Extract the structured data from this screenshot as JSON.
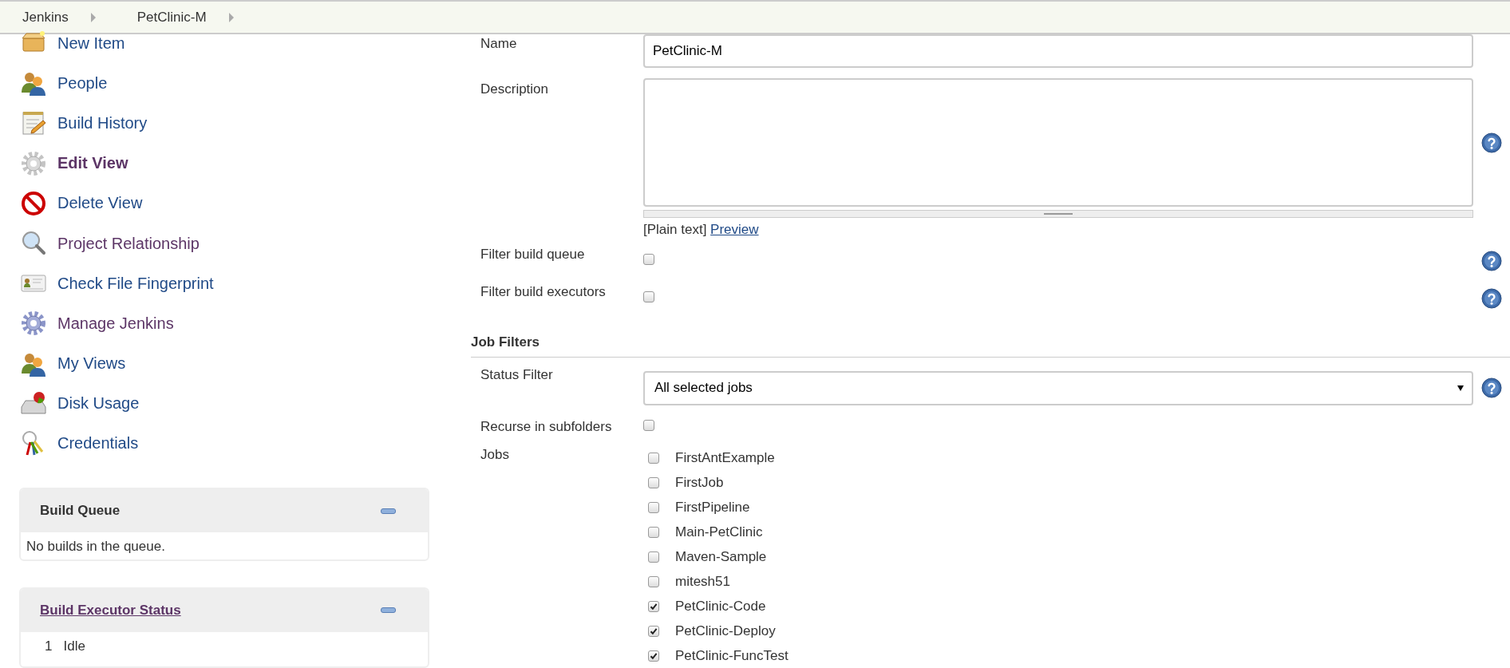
{
  "breadcrumbs": [
    {
      "label": "Jenkins"
    },
    {
      "label": "PetClinic-M"
    }
  ],
  "sidebar": {
    "items": [
      {
        "label": "New Item",
        "selected": false,
        "visited": false
      },
      {
        "label": "People",
        "selected": false,
        "visited": false
      },
      {
        "label": "Build History",
        "selected": false,
        "visited": false
      },
      {
        "label": "Edit View",
        "selected": true,
        "visited": true
      },
      {
        "label": "Delete View",
        "selected": false,
        "visited": false
      },
      {
        "label": "Project Relationship",
        "selected": false,
        "visited": true
      },
      {
        "label": "Check File Fingerprint",
        "selected": false,
        "visited": false
      },
      {
        "label": "Manage Jenkins",
        "selected": false,
        "visited": true
      },
      {
        "label": "My Views",
        "selected": false,
        "visited": false
      },
      {
        "label": "Disk Usage",
        "selected": false,
        "visited": false
      },
      {
        "label": "Credentials",
        "selected": false,
        "visited": false
      }
    ]
  },
  "build_queue": {
    "title": "Build Queue",
    "message": "No builds in the queue."
  },
  "build_executor_status": {
    "title": "Build Executor Status",
    "executors": [
      {
        "number": "1",
        "status": "Idle"
      }
    ]
  },
  "form": {
    "name": {
      "label": "Name",
      "value": "PetClinic-M"
    },
    "description": {
      "label": "Description",
      "format": "[Plain text]",
      "preview_link": "Preview"
    },
    "filter_build_queue": {
      "label": "Filter build queue",
      "checked": false
    },
    "filter_build_executors": {
      "label": "Filter build executors",
      "checked": false
    },
    "job_filters": {
      "title": "Job Filters"
    },
    "status_filter": {
      "label": "Status Filter",
      "value": "All selected jobs"
    },
    "recurse_in_subfolders": {
      "label": "Recurse in subfolders",
      "checked": false
    },
    "jobs": {
      "label": "Jobs",
      "items": [
        {
          "name": "FirstAntExample",
          "checked": false
        },
        {
          "name": "FirstJob",
          "checked": false
        },
        {
          "name": "FirstPipeline",
          "checked": false
        },
        {
          "name": "Main-PetClinic",
          "checked": false
        },
        {
          "name": "Maven-Sample",
          "checked": false
        },
        {
          "name": "mitesh51",
          "checked": false
        },
        {
          "name": "PetClinic-Code",
          "checked": true
        },
        {
          "name": "PetClinic-Deploy",
          "checked": true
        },
        {
          "name": "PetClinic-FuncTest",
          "checked": true
        }
      ]
    }
  }
}
